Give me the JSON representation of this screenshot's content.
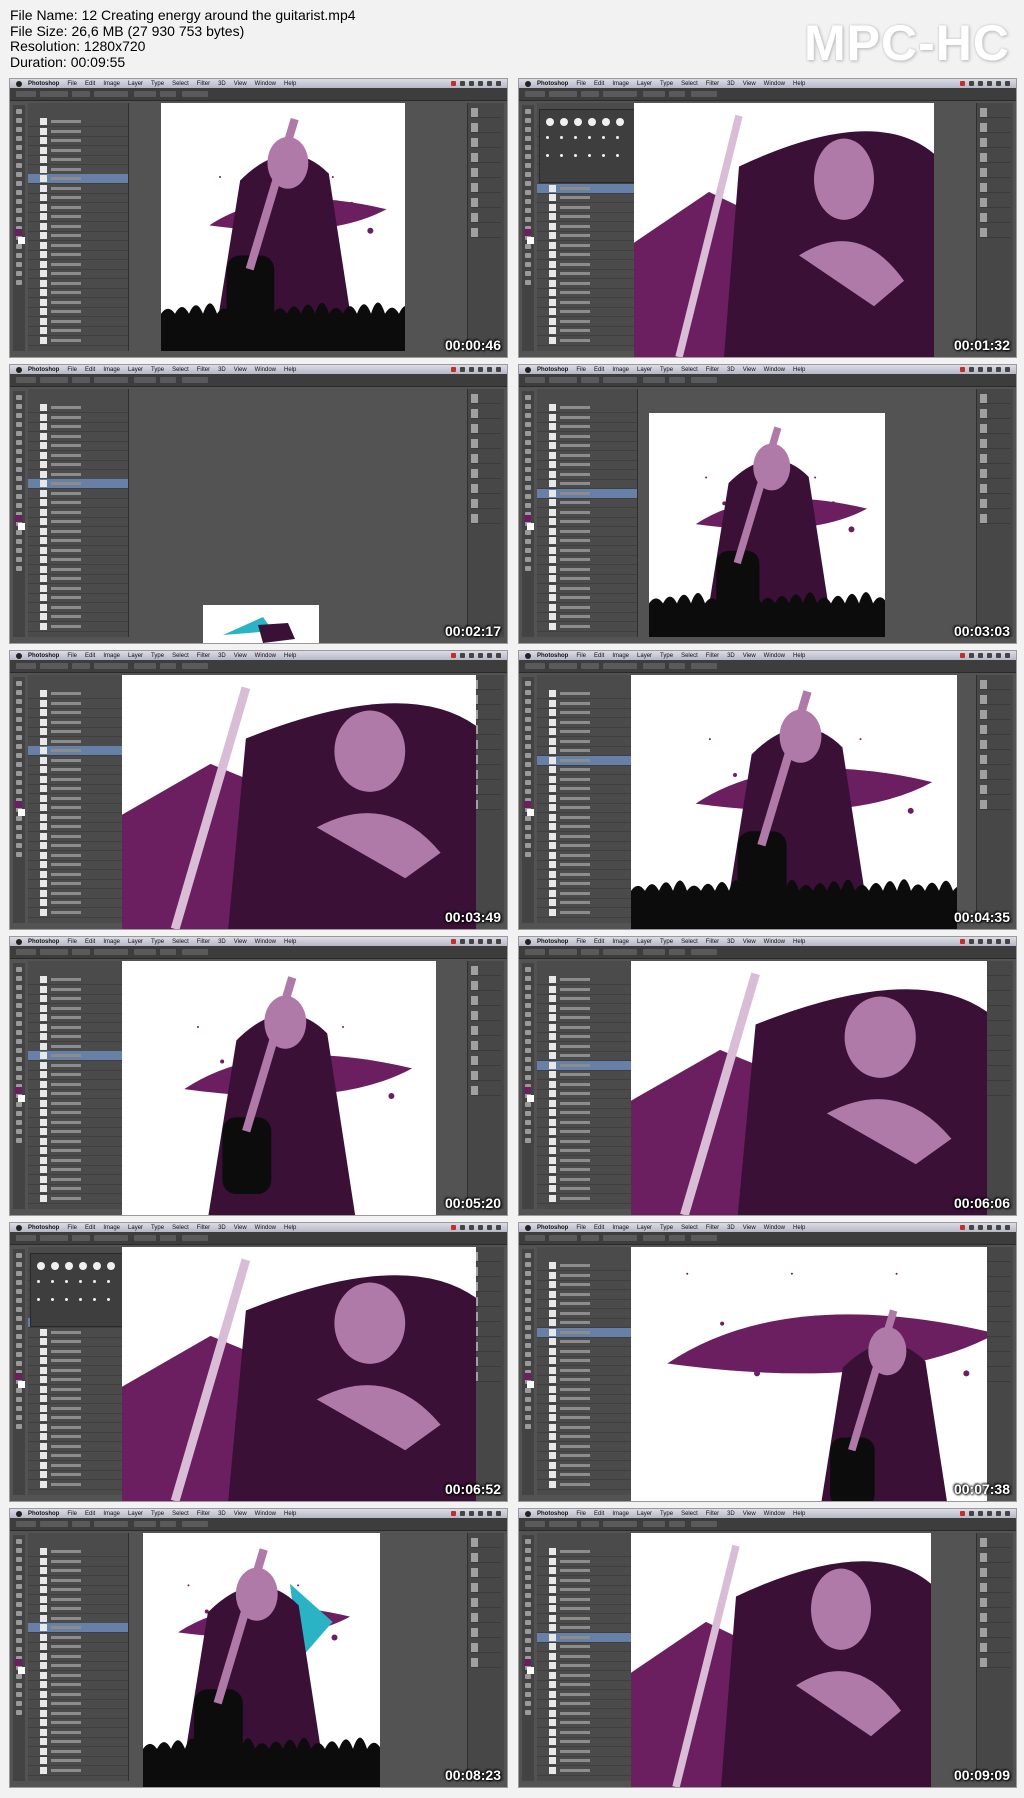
{
  "file_info": {
    "name": "File Name: 12 Creating energy around the guitarist.mp4",
    "size": "File Size: 26,6 MB (27 930 753 bytes)",
    "resolution": "Resolution: 1280x720",
    "duration": "Duration: 00:09:55"
  },
  "brand": "MPC-HC",
  "menu": {
    "app": "Photoshop",
    "items": [
      "File",
      "Edit",
      "Image",
      "Layer",
      "Type",
      "Select",
      "Filter",
      "3D",
      "View",
      "Window",
      "Help"
    ]
  },
  "colors": {
    "purple": "#6b1f60",
    "dark_purple": "#3a1036",
    "light_purple": "#b07aa8",
    "cyan": "#2ab3c4",
    "black": "#0c0c0c"
  },
  "thumbnails": [
    {
      "timestamp": "00:00:46"
    },
    {
      "timestamp": "00:01:32"
    },
    {
      "timestamp": "00:02:17"
    },
    {
      "timestamp": "00:03:03"
    },
    {
      "timestamp": "00:03:49"
    },
    {
      "timestamp": "00:04:35"
    },
    {
      "timestamp": "00:05:20"
    },
    {
      "timestamp": "00:06:06"
    },
    {
      "timestamp": "00:06:52"
    },
    {
      "timestamp": "00:07:38"
    },
    {
      "timestamp": "00:08:23"
    },
    {
      "timestamp": "00:09:09"
    }
  ]
}
